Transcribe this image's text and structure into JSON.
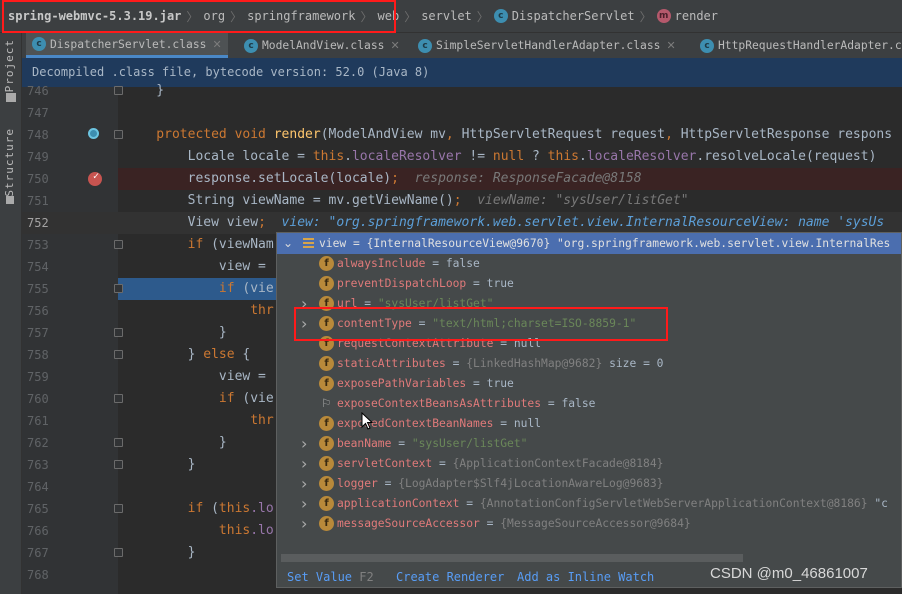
{
  "breadcrumb": [
    {
      "label": "spring-webmvc-5.3.19.jar",
      "icon": ""
    },
    {
      "label": "org",
      "icon": ""
    },
    {
      "label": "springframework",
      "icon": ""
    },
    {
      "label": "web",
      "icon": ""
    },
    {
      "label": "servlet",
      "icon": ""
    },
    {
      "label": "DispatcherServlet",
      "icon": "class-icon"
    },
    {
      "label": "render",
      "icon": "method-icon"
    }
  ],
  "sidebar": {
    "project": "Project",
    "structure": "Structure"
  },
  "tabs": [
    {
      "label": "DispatcherServlet.class",
      "active": true
    },
    {
      "label": "ModelAndView.class",
      "active": false
    },
    {
      "label": "SimpleServletHandlerAdapter.class",
      "active": false
    },
    {
      "label": "HttpRequestHandlerAdapter.c",
      "active": false
    }
  ],
  "banner": "Decompiled .class file, bytecode version: 52.0 (Java 8)",
  "code": [
    {
      "num": "746",
      "state": "",
      "fold": true,
      "tokens": [
        [
          "    }",
          "p"
        ]
      ]
    },
    {
      "num": "747",
      "state": "",
      "tokens": []
    },
    {
      "num": "748",
      "state": "",
      "fold": true,
      "gutter": "override",
      "tokens": [
        [
          "    protected void ",
          "k"
        ],
        [
          "render",
          "m"
        ],
        [
          "(ModelAndView mv",
          "p"
        ],
        [
          ", ",
          "k"
        ],
        [
          "HttpServletRequest request",
          "p"
        ],
        [
          ", ",
          "k"
        ],
        [
          "HttpServletResponse respons",
          "p"
        ]
      ]
    },
    {
      "num": "749",
      "state": "",
      "tokens": [
        [
          "        Locale locale = ",
          "p"
        ],
        [
          "this",
          "k"
        ],
        [
          ".",
          "p"
        ],
        [
          "localeResolver",
          "f"
        ],
        [
          " != ",
          "p"
        ],
        [
          "null",
          "k"
        ],
        [
          " ? ",
          "p"
        ],
        [
          "this",
          "k"
        ],
        [
          ".",
          "p"
        ],
        [
          "localeResolver",
          "f"
        ],
        [
          ".resolveLocale(request)",
          "p"
        ]
      ]
    },
    {
      "num": "750",
      "state": "bp",
      "gutter": "breakpoint",
      "tokens": [
        [
          "        response.setLocale(locale)",
          "p"
        ],
        [
          ";",
          "k"
        ],
        [
          "  response: ResponseFacade@8158",
          "h"
        ]
      ]
    },
    {
      "num": "751",
      "state": "",
      "tokens": [
        [
          "        String viewName = mv.getViewName()",
          "p"
        ],
        [
          ";",
          "k"
        ],
        [
          "  viewName: \"sysUser/listGet\"",
          "h"
        ]
      ]
    },
    {
      "num": "752",
      "state": "cur",
      "tokens": [
        [
          "        View view",
          "p"
        ],
        [
          ";",
          "k"
        ],
        [
          "  view: \"org.springframework.web.servlet.view.InternalResourceView: name 'sysUs",
          "hb"
        ]
      ]
    },
    {
      "num": "753",
      "state": "",
      "fold": true,
      "tokens": [
        [
          "        if ",
          "k"
        ],
        [
          "(viewNam",
          "p"
        ]
      ]
    },
    {
      "num": "754",
      "state": "",
      "tokens": [
        [
          "            view =",
          "p"
        ]
      ]
    },
    {
      "num": "755",
      "state": "exec",
      "fold": true,
      "tokens": [
        [
          "            if ",
          "k"
        ],
        [
          "(vie",
          "p"
        ]
      ]
    },
    {
      "num": "756",
      "state": "",
      "tokens": [
        [
          "                thr",
          "k"
        ]
      ]
    },
    {
      "num": "757",
      "state": "",
      "fold": true,
      "tokens": [
        [
          "            }",
          "p"
        ]
      ]
    },
    {
      "num": "758",
      "state": "",
      "fold": true,
      "tokens": [
        [
          "        } ",
          "p"
        ],
        [
          "else ",
          "k"
        ],
        [
          "{",
          "p"
        ]
      ]
    },
    {
      "num": "759",
      "state": "",
      "tokens": [
        [
          "            view =",
          "p"
        ]
      ]
    },
    {
      "num": "760",
      "state": "",
      "fold": true,
      "tokens": [
        [
          "            if ",
          "k"
        ],
        [
          "(vie",
          "p"
        ]
      ]
    },
    {
      "num": "761",
      "state": "",
      "tokens": [
        [
          "                thr",
          "k"
        ]
      ]
    },
    {
      "num": "762",
      "state": "",
      "fold": true,
      "tokens": [
        [
          "            }",
          "p"
        ]
      ]
    },
    {
      "num": "763",
      "state": "",
      "fold": true,
      "tokens": [
        [
          "        }",
          "p"
        ]
      ]
    },
    {
      "num": "764",
      "state": "",
      "tokens": []
    },
    {
      "num": "765",
      "state": "",
      "fold": true,
      "tokens": [
        [
          "        if ",
          "k"
        ],
        [
          "(",
          "p"
        ],
        [
          "this",
          "k"
        ],
        [
          ".lo",
          "f"
        ]
      ]
    },
    {
      "num": "766",
      "state": "",
      "tokens": [
        [
          "            ",
          "p"
        ],
        [
          "this",
          "k"
        ],
        [
          ".lo",
          "f"
        ]
      ]
    },
    {
      "num": "767",
      "state": "",
      "fold": true,
      "tokens": [
        [
          "        }",
          "p"
        ]
      ]
    },
    {
      "num": "768",
      "state": "",
      "tokens": []
    }
  ],
  "popup": {
    "header": "view = {InternalResourceView@9670} \"org.springframework.web.servlet.view.InternalRes",
    "rows": [
      {
        "expand": false,
        "icon": "field",
        "name": "alwaysInclude",
        "value": "false",
        "type": "kw",
        "extra": ""
      },
      {
        "expand": false,
        "icon": "field",
        "name": "preventDispatchLoop",
        "value": "true",
        "type": "kw",
        "extra": ""
      },
      {
        "expand": true,
        "icon": "field",
        "name": "url",
        "value": "\"sysUser/listGet\"",
        "type": "str",
        "extra": ""
      },
      {
        "expand": true,
        "icon": "field",
        "name": "contentType",
        "value": "\"text/html;charset=ISO-8859-1\"",
        "type": "str",
        "extra": ""
      },
      {
        "expand": false,
        "icon": "field",
        "name": "requestContextAttribute",
        "value": "null",
        "type": "kw",
        "extra": ""
      },
      {
        "expand": false,
        "icon": "field",
        "name": "staticAttributes",
        "value": "{LinkedHashMap@9682}",
        "type": "ref",
        "extra": "  size = 0"
      },
      {
        "expand": false,
        "icon": "field",
        "name": "exposePathVariables",
        "value": "true",
        "type": "kw",
        "extra": ""
      },
      {
        "expand": false,
        "icon": "flag",
        "name": "exposeContextBeansAsAttributes",
        "value": "false",
        "type": "kw",
        "extra": ""
      },
      {
        "expand": false,
        "icon": "field",
        "name": "exposedContextBeanNames",
        "value": "null",
        "type": "kw",
        "extra": ""
      },
      {
        "expand": true,
        "icon": "field",
        "name": "beanName",
        "value": "\"sysUser/listGet\"",
        "type": "str",
        "extra": ""
      },
      {
        "expand": true,
        "icon": "field",
        "name": "servletContext",
        "value": "{ApplicationContextFacade@8184}",
        "type": "ref",
        "extra": ""
      },
      {
        "expand": true,
        "icon": "field",
        "name": "logger",
        "value": "{LogAdapter$Slf4jLocationAwareLog@9683}",
        "type": "ref",
        "extra": ""
      },
      {
        "expand": true,
        "icon": "field",
        "name": "applicationContext",
        "value": "{AnnotationConfigServletWebServerApplicationContext@8186}",
        "type": "ref",
        "extra": " \"c"
      },
      {
        "expand": true,
        "icon": "field",
        "name": "messageSourceAccessor",
        "value": "{MessageSourceAccessor@9684}",
        "type": "ref",
        "extra": ""
      }
    ],
    "footer": {
      "set_value": "Set Value",
      "set_value_key": "F2",
      "create_renderer": "Create Renderer",
      "inline_watch": "Add as Inline Watch"
    }
  },
  "watermark": "CSDN @m0_46861007",
  "colors": {
    "accent": "#4b6eaf",
    "annotation": "#ff1a1a",
    "keyword": "#cc7832",
    "string": "#6a8759"
  }
}
